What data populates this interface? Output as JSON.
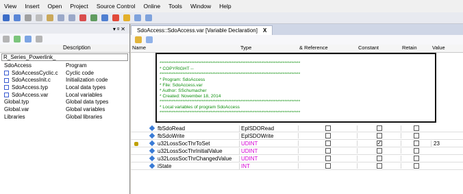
{
  "menu": [
    "View",
    "Insert",
    "Open",
    "Project",
    "Source Control",
    "Online",
    "Tools",
    "Window",
    "Help"
  ],
  "left_panel": {
    "description_header": "Description",
    "root_value": "R_Series_Powerlink_",
    "items": [
      {
        "name": "SdoAccess",
        "desc": "Program"
      },
      {
        "name": "SdoAccessCyclic.c",
        "desc": "Cyclic code"
      },
      {
        "name": "SdoAccessInit.c",
        "desc": "Initialization code"
      },
      {
        "name": "SdoAccess.typ",
        "desc": "Local data types"
      },
      {
        "name": "SdoAccess.var",
        "desc": "Local variables"
      },
      {
        "name": "Global.typ",
        "desc": "Global data types"
      },
      {
        "name": "Global.var",
        "desc": "Global variables"
      },
      {
        "name": "Libraries",
        "desc": "Global libraries"
      }
    ]
  },
  "tab": {
    "title": "SdoAccess::SdoAccess.var [Variable Declaration]",
    "close": "X"
  },
  "table_headers": {
    "name": "Name",
    "type": "Type",
    "reference": "& Reference",
    "constant": "Constant",
    "retain": "Retain",
    "value": "Value"
  },
  "comment_lines": [
    "********************************************************************************",
    "* COPYRIGHT --",
    "********************************************************************************",
    "* Program: SdoAccess",
    "* File: SdoAccess.var",
    "* Author: SSchumacher",
    "* Created: November 18, 2014",
    "********************************************************************************",
    "* Local variables of program SdoAccess",
    "********************************************************************************"
  ],
  "rows": [
    {
      "name": "fbSdoRead",
      "type": "EplSDORead",
      "ref": false,
      "const": false,
      "retain": false,
      "value": ""
    },
    {
      "name": "fbSdoWrite",
      "type": "EplSDOWrite",
      "ref": false,
      "const": false,
      "retain": false,
      "value": ""
    },
    {
      "name": "u32LossSocThrToSet",
      "type": "UDINT",
      "ref": false,
      "const": true,
      "retain": false,
      "value": "23"
    },
    {
      "name": "u32LossSocThrInitialValue",
      "type": "UDINT",
      "ref": false,
      "const": false,
      "retain": false,
      "value": ""
    },
    {
      "name": "u32LossSocThrChangedValue",
      "type": "UDINT",
      "ref": false,
      "const": false,
      "retain": false,
      "value": ""
    },
    {
      "name": "iState",
      "type": "INT",
      "ref": false,
      "const": false,
      "retain": false,
      "value": ""
    }
  ]
}
